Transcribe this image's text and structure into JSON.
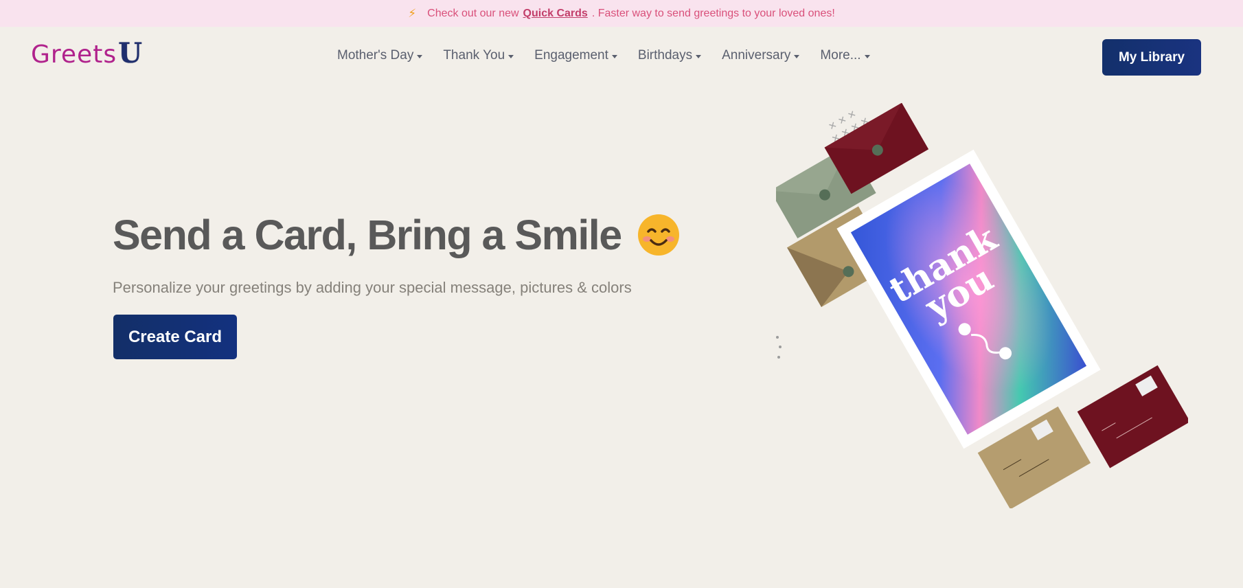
{
  "announcement": {
    "prefix": "Check out our new ",
    "link": "Quick Cards",
    "suffix": ". Faster way to send greetings to your loved ones!",
    "icon": "lightning-icon"
  },
  "logo": {
    "text": "Greets",
    "accent": "U"
  },
  "nav": {
    "items": [
      {
        "label": "Mother's Day"
      },
      {
        "label": "Thank You"
      },
      {
        "label": "Engagement"
      },
      {
        "label": "Birthdays"
      },
      {
        "label": "Anniversary"
      },
      {
        "label": "More..."
      }
    ]
  },
  "header": {
    "library_label": "My Library"
  },
  "hero": {
    "title": "Send a Card, Bring a Smile",
    "emoji": "smiling-face-icon",
    "subtitle": "Personalize your greetings by adding your special message, pictures & colors",
    "cta_label": "Create Card"
  },
  "illustration": {
    "card_text_line1": "thank",
    "card_text_line2": "you"
  },
  "colors": {
    "brand_navy": "#13306b",
    "logo_magenta": "#b0228c",
    "background": "#f2efe9",
    "banner_bg": "#f9e3ee",
    "banner_text": "#d9507a"
  }
}
